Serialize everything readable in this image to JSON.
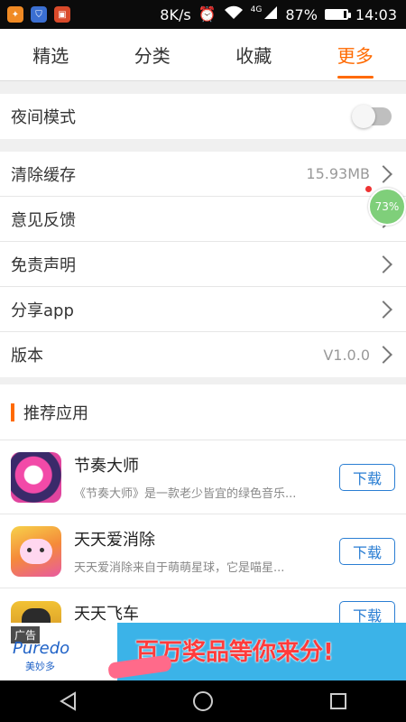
{
  "status_bar": {
    "network_speed": "8K/s",
    "signal_type": "4G",
    "battery_percent": "87%",
    "battery_level": 0.87,
    "time": "14:03",
    "icons": [
      "alarm-icon",
      "wifi-icon",
      "signal-icon",
      "battery-icon"
    ]
  },
  "tabs": [
    {
      "label": "精选"
    },
    {
      "label": "分类"
    },
    {
      "label": "收藏"
    },
    {
      "label": "更多",
      "active": true
    }
  ],
  "settings": {
    "night_mode": {
      "label": "夜间模式",
      "enabled": false
    },
    "clear_cache": {
      "label": "清除缓存",
      "value": "15.93MB"
    },
    "feedback": {
      "label": "意见反馈"
    },
    "disclaimer": {
      "label": "免责声明"
    },
    "share": {
      "label": "分享app"
    },
    "version": {
      "label": "版本",
      "value": "V1.0.0"
    }
  },
  "recommend": {
    "title": "推荐应用",
    "apps": [
      {
        "name": "节奏大师",
        "desc": "《节奏大师》是一款老少皆宜的绿色音乐...",
        "button": "下载"
      },
      {
        "name": "天天爱消除",
        "desc": "天天爱消除来自于萌萌星球，它是喵星...",
        "button": "下载"
      },
      {
        "name": "天天飞车",
        "desc": "",
        "button": "下载"
      }
    ]
  },
  "ad": {
    "tag": "广告",
    "brand": "Puredo",
    "brand_cn": "美妙多",
    "headline": "百万奖品等你来分!"
  },
  "floating_widget": {
    "label": "73%"
  },
  "colors": {
    "accent": "#ff6a00",
    "download": "#2a7ed3"
  }
}
